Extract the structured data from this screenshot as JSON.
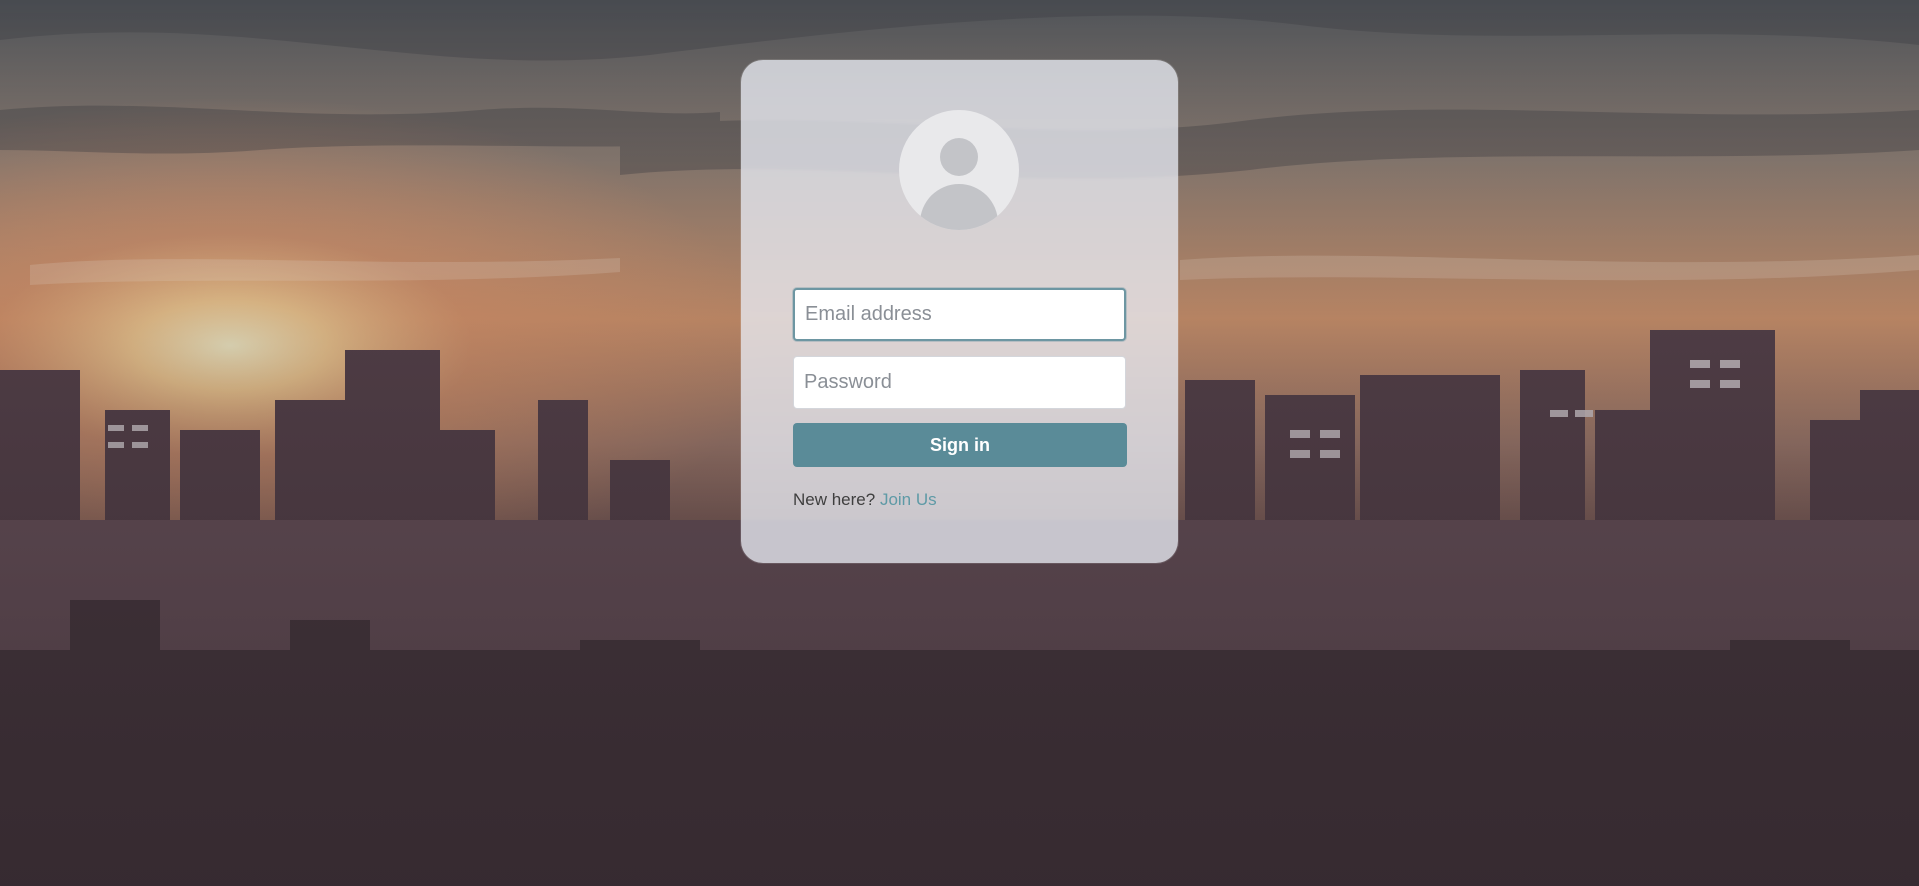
{
  "login": {
    "email_placeholder": "Email address",
    "password_placeholder": "Password",
    "signin_label": "Sign in",
    "new_here_text": "New here?",
    "join_link": "Join Us"
  },
  "theme": {
    "accent": "#5a8b98",
    "link": "#5e9aa6",
    "card_bg": "#e8ebf2"
  },
  "icons": {
    "avatar": "user-avatar-icon"
  }
}
